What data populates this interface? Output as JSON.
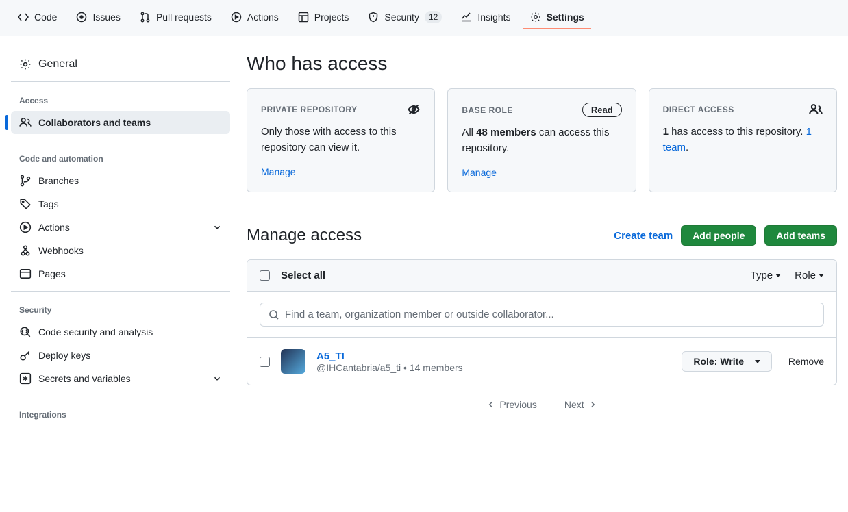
{
  "topnav": {
    "tabs": [
      {
        "label": "Code"
      },
      {
        "label": "Issues"
      },
      {
        "label": "Pull requests"
      },
      {
        "label": "Actions"
      },
      {
        "label": "Projects"
      },
      {
        "label": "Security",
        "count": "12"
      },
      {
        "label": "Insights"
      },
      {
        "label": "Settings",
        "active": true
      }
    ]
  },
  "sidebar": {
    "general": "General",
    "groups": [
      {
        "heading": "Access",
        "items": [
          {
            "label": "Collaborators and teams",
            "icon": "people-icon",
            "active": true
          }
        ]
      },
      {
        "heading": "Code and automation",
        "items": [
          {
            "label": "Branches",
            "icon": "branch-icon"
          },
          {
            "label": "Tags",
            "icon": "tag-icon"
          },
          {
            "label": "Actions",
            "icon": "play-circle-icon",
            "chevron": true
          },
          {
            "label": "Webhooks",
            "icon": "webhook-icon"
          },
          {
            "label": "Pages",
            "icon": "browser-icon"
          }
        ]
      },
      {
        "heading": "Security",
        "items": [
          {
            "label": "Code security and analysis",
            "icon": "codescan-icon"
          },
          {
            "label": "Deploy keys",
            "icon": "key-icon"
          },
          {
            "label": "Secrets and variables",
            "icon": "asterisk-icon",
            "chevron": true
          }
        ]
      },
      {
        "heading": "Integrations",
        "items": []
      }
    ]
  },
  "main": {
    "who_heading": "Who has access",
    "cards": {
      "private": {
        "title": "PRIVATE REPOSITORY",
        "body": "Only those with access to this repository can view it.",
        "manage": "Manage"
      },
      "base": {
        "title": "BASE ROLE",
        "badge": "Read",
        "body_prefix": "All ",
        "body_bold": "48 members",
        "body_suffix": " can access this repository.",
        "manage": "Manage"
      },
      "direct": {
        "title": "DIRECT ACCESS",
        "body_bold": "1",
        "body_suffix": " has access to this repository. ",
        "team_link": "1 team",
        "period": "."
      }
    },
    "manage_heading": "Manage access",
    "create_team": "Create team",
    "add_people": "Add people",
    "add_teams": "Add teams",
    "list": {
      "select_all": "Select all",
      "type_dd": "Type",
      "role_dd": "Role",
      "search_placeholder": "Find a team, organization member or outside collaborator...",
      "rows": [
        {
          "name": "A5_TI",
          "sub": "@IHCantabria/a5_ti • 14 members",
          "role_label": "Role: ",
          "role_value": "Write",
          "remove": "Remove"
        }
      ]
    },
    "pager": {
      "prev": "Previous",
      "next": "Next"
    }
  }
}
